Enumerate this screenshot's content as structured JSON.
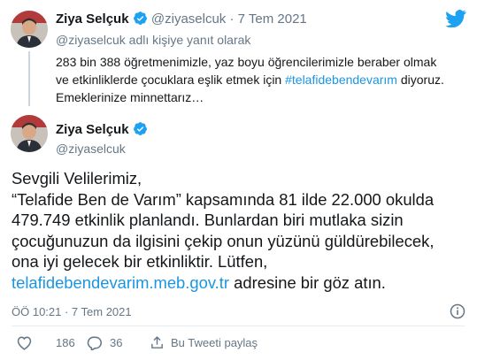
{
  "reply_tweet": {
    "author_name": "Ziya Selçuk",
    "author_handle": "@ziyaselcuk",
    "separator": "·",
    "date": "7 Tem 2021",
    "reply_context": "@ziyaselcuk adlı kişiye yanıt olarak",
    "text_part1": "283 bin 388 öğretmenimizle, yaz boyu öğrencilerimizle beraber olmak ve etkinliklerde çocuklara eşlik etmek için ",
    "hashtag": "#telafidebendevarım",
    "text_part2": " diyoruz. Emeklerinize minnettarız…"
  },
  "main_tweet": {
    "author_name": "Ziya Selçuk",
    "author_handle": "@ziyaselcuk",
    "line1": "Sevgili Velilerimiz,",
    "line2": "“Telafide Ben de Varım” kapsamında 81 ilde 22.000 okulda 479.749 etkinlik planlandı. Bunlardan biri mutlaka sizin çocuğunuzun da ilgisini çekip onun yüzünü güldürebilecek, ona iyi gelecek bir etkinliktir. Lütfen, ",
    "link": "telafidebendevarim.meb.gov.tr",
    "line2_end": " adresine bir göz atın.",
    "timestamp": "ÖÖ 10:21 · 7 Tem 2021"
  },
  "actions": {
    "likes": "186",
    "replies": "36",
    "share_label": "Bu Tweeti paylaş"
  },
  "colors": {
    "twitter_blue": "#1da1f2",
    "like_red": "#e0245e",
    "link_blue": "#1b95e0",
    "muted_gray": "#657786"
  }
}
